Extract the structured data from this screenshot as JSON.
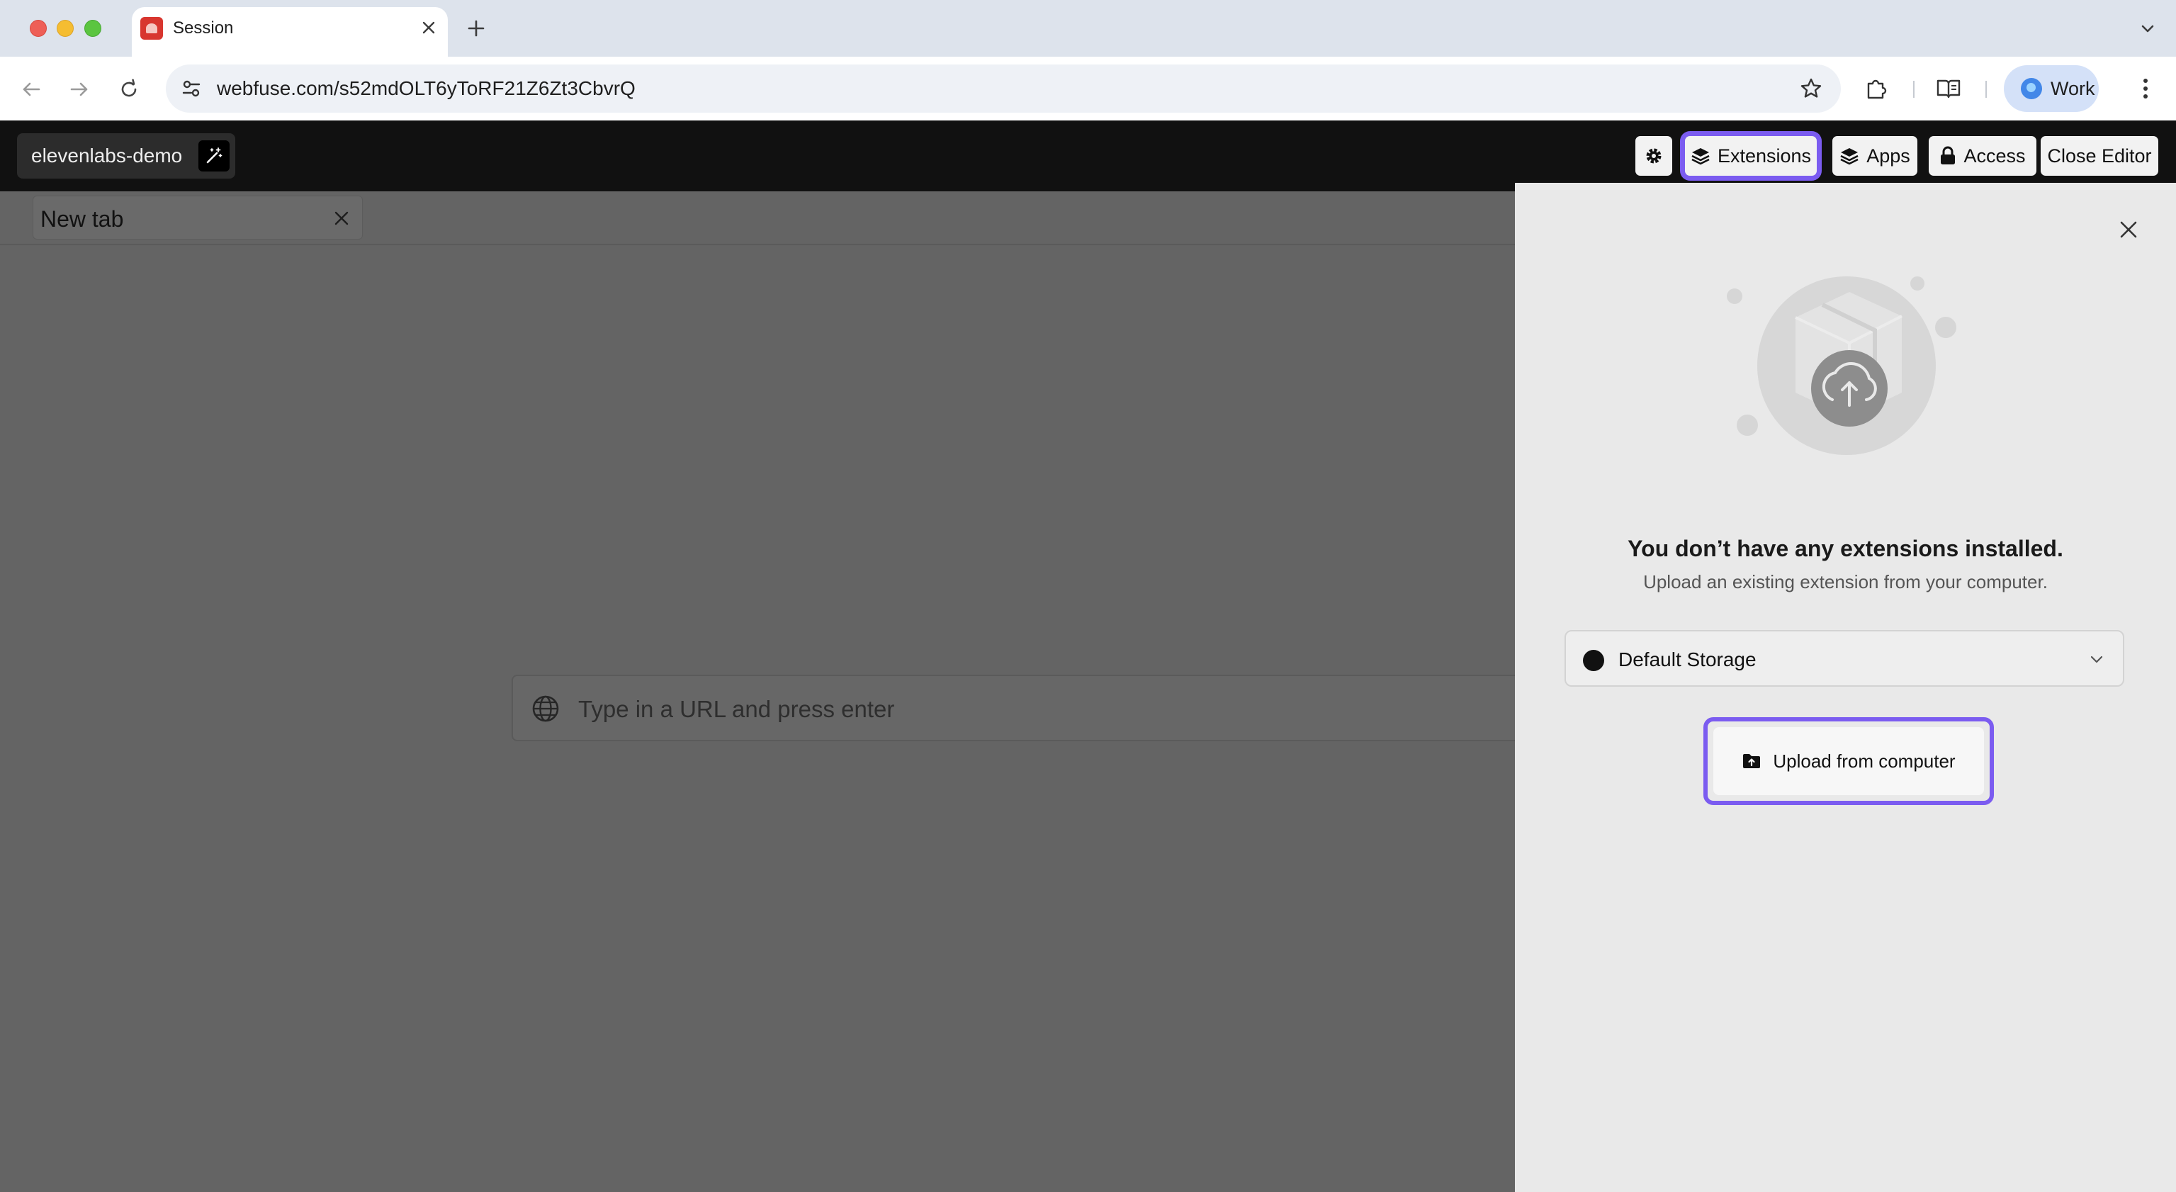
{
  "browser": {
    "tab_title": "Session",
    "url": "webfuse.com/s52mdOLT6yToRF21Z6Zt3CbvrQ",
    "profile_label": "Work"
  },
  "app_header": {
    "project_name": "elevenlabs-demo",
    "buttons": {
      "extensions": "Extensions",
      "apps": "Apps",
      "access": "Access",
      "close_editor": "Close Editor"
    }
  },
  "workspace": {
    "tab_title": "New tab",
    "url_placeholder": "Type in a URL and press enter"
  },
  "extensions_panel": {
    "empty_title": "You don’t have any extensions installed.",
    "empty_subtitle": "Upload an existing extension from your computer.",
    "storage_selected": "Default Storage",
    "upload_label": "Upload from computer"
  },
  "colors": {
    "focus_ring": "#7b5cf0",
    "header_bg": "#111111",
    "overlay": "#646464",
    "panel_bg": "#e9e9e9"
  }
}
